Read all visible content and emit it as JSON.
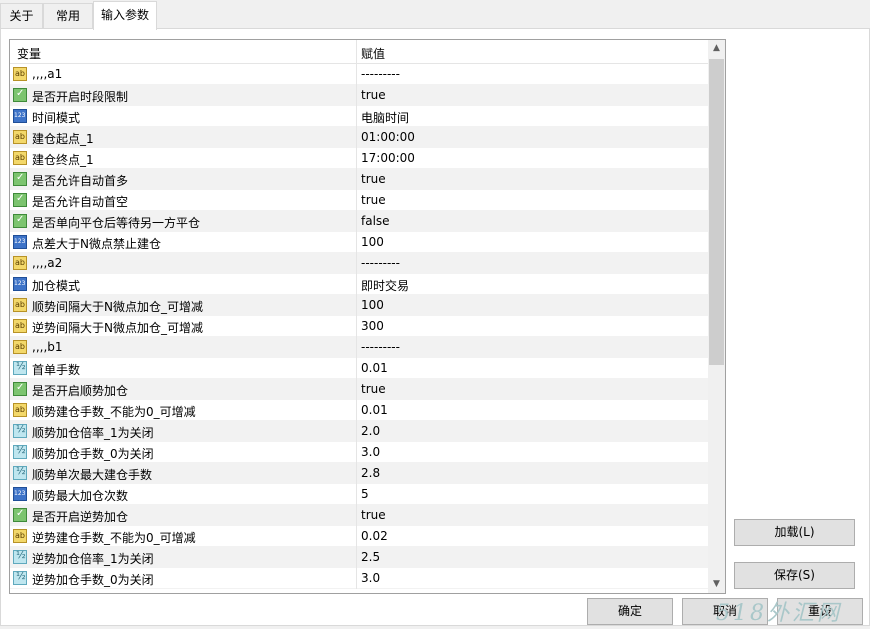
{
  "tabs": [
    "关于",
    "常用",
    "输入参数"
  ],
  "grid": {
    "header": {
      "variable": "变量",
      "value": "赋值"
    },
    "rows": [
      {
        "type": "string",
        "name": ",,,,a1",
        "value": "---------"
      },
      {
        "type": "bool",
        "name": "是否开启时段限制",
        "value": "true"
      },
      {
        "type": "int",
        "name": "时间模式",
        "value": "电脑时间"
      },
      {
        "type": "string",
        "name": "建仓起点_1",
        "value": "01:00:00"
      },
      {
        "type": "string",
        "name": "建仓终点_1",
        "value": "17:00:00"
      },
      {
        "type": "bool",
        "name": "是否允许自动首多",
        "value": "true"
      },
      {
        "type": "bool",
        "name": "是否允许自动首空",
        "value": "true"
      },
      {
        "type": "bool",
        "name": "是否单向平仓后等待另一方平仓",
        "value": "false"
      },
      {
        "type": "int",
        "name": "点差大于N微点禁止建仓",
        "value": "100"
      },
      {
        "type": "string",
        "name": ",,,,a2",
        "value": "---------"
      },
      {
        "type": "int",
        "name": "加仓模式",
        "value": "即时交易"
      },
      {
        "type": "string",
        "name": "顺势间隔大于N微点加仓_可增减",
        "value": "100"
      },
      {
        "type": "string",
        "name": "逆势间隔大于N微点加仓_可增减",
        "value": "300"
      },
      {
        "type": "string",
        "name": ",,,,b1",
        "value": "---------"
      },
      {
        "type": "double",
        "name": "首单手数",
        "value": "0.01"
      },
      {
        "type": "bool",
        "name": "是否开启顺势加仓",
        "value": "true"
      },
      {
        "type": "string",
        "name": "顺势建仓手数_不能为0_可增减",
        "value": "0.01"
      },
      {
        "type": "double",
        "name": "顺势加仓倍率_1为关闭",
        "value": "2.0"
      },
      {
        "type": "double",
        "name": "顺势加仓手数_0为关闭",
        "value": "3.0"
      },
      {
        "type": "double",
        "name": "顺势单次最大建仓手数",
        "value": "2.8"
      },
      {
        "type": "int",
        "name": "顺势最大加仓次数",
        "value": "5"
      },
      {
        "type": "bool",
        "name": "是否开启逆势加仓",
        "value": "true"
      },
      {
        "type": "string",
        "name": "逆势建仓手数_不能为0_可增减",
        "value": "0.02"
      },
      {
        "type": "double",
        "name": "逆势加仓倍率_1为关闭",
        "value": "2.5"
      },
      {
        "type": "double",
        "name": "逆势加仓手数_0为关闭",
        "value": "3.0"
      }
    ]
  },
  "buttons": {
    "load": "加载(L)",
    "save": "保存(S)",
    "ok": "确定",
    "cancel": "取消",
    "reset": "重设"
  },
  "watermark": "518外汇网"
}
